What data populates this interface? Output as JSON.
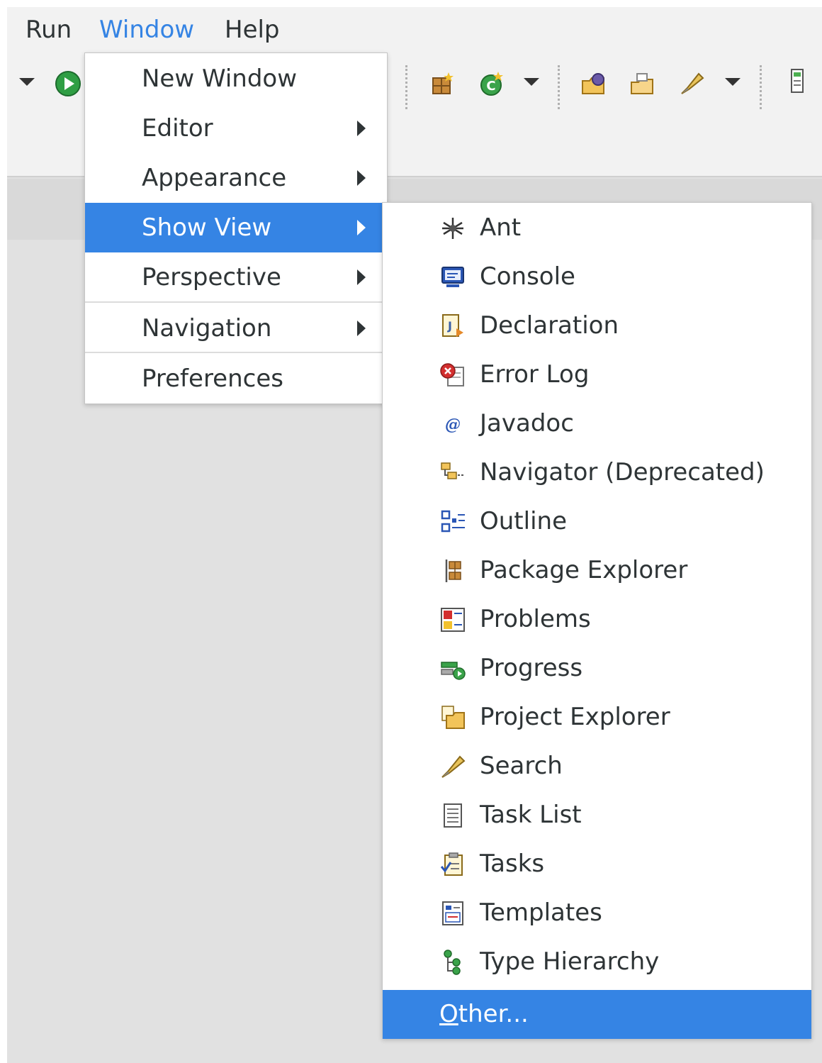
{
  "menubar": {
    "items": [
      {
        "label": "Run"
      },
      {
        "label": "Window"
      },
      {
        "label": "Help"
      }
    ]
  },
  "toolbar": {
    "icons": [
      "dropdown-arrow",
      "run-icon",
      "new-class-icon",
      "refresh-icon",
      "open-type-icon",
      "open-folder-icon",
      "search-icon",
      "panel-icon"
    ]
  },
  "window_menu": {
    "items": [
      {
        "label": "New Window",
        "submenu": false
      },
      {
        "label": "Editor",
        "submenu": true
      },
      {
        "label": "Appearance",
        "submenu": true
      },
      {
        "label": "Show View",
        "submenu": true,
        "highlighted": true
      },
      {
        "label": "Perspective",
        "submenu": true
      },
      {
        "label": "Navigation",
        "submenu": true
      },
      {
        "label": "Preferences",
        "submenu": false
      }
    ]
  },
  "show_view_menu": {
    "items": [
      {
        "label": "Ant",
        "icon": "ant-icon"
      },
      {
        "label": "Console",
        "icon": "console-icon"
      },
      {
        "label": "Declaration",
        "icon": "declaration-icon"
      },
      {
        "label": "Error Log",
        "icon": "error-log-icon"
      },
      {
        "label": "Javadoc",
        "icon": "javadoc-icon"
      },
      {
        "label": "Navigator (Deprecated)",
        "icon": "navigator-icon"
      },
      {
        "label": "Outline",
        "icon": "outline-icon"
      },
      {
        "label": "Package Explorer",
        "icon": "package-explorer-icon"
      },
      {
        "label": "Problems",
        "icon": "problems-icon"
      },
      {
        "label": "Progress",
        "icon": "progress-icon"
      },
      {
        "label": "Project Explorer",
        "icon": "project-explorer-icon"
      },
      {
        "label": "Search",
        "icon": "search-icon"
      },
      {
        "label": "Task List",
        "icon": "task-list-icon"
      },
      {
        "label": "Tasks",
        "icon": "tasks-icon"
      },
      {
        "label": "Templates",
        "icon": "templates-icon"
      },
      {
        "label": "Type Hierarchy",
        "icon": "type-hierarchy-icon"
      }
    ],
    "other": {
      "mnemonic": "O",
      "rest": "ther..."
    }
  },
  "colors": {
    "accent": "#3584e4",
    "menubar_bg": "#f2f2f2",
    "workspace_bg": "#e1e1e1"
  }
}
